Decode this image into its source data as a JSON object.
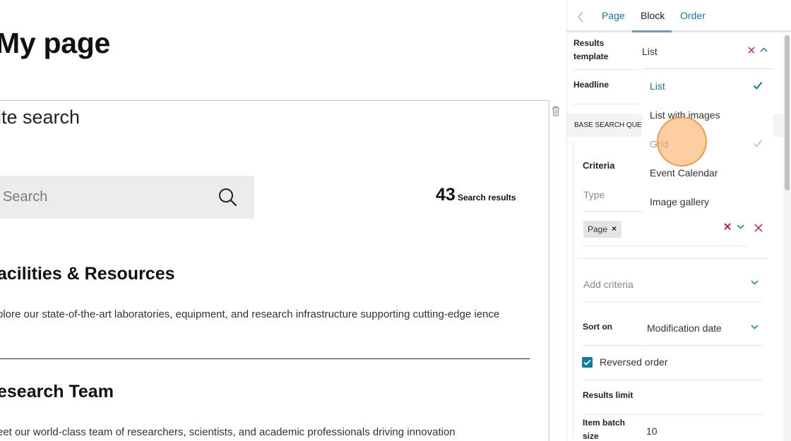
{
  "page": {
    "title": "My page"
  },
  "block": {
    "title": "ite search",
    "search": {
      "placeholder": "Search"
    },
    "results": {
      "count": "43",
      "count_label": "Search results"
    },
    "items": [
      {
        "title": "acilities & Resources",
        "description": "plore our state-of-the-art laboratories, equipment, and research infrastructure supporting cutting-edge ience"
      },
      {
        "title": "esearch Team",
        "description": "eet our world-class team of researchers, scientists, and academic professionals driving innovation"
      }
    ]
  },
  "sidebar": {
    "tabs": [
      {
        "label": "Page",
        "active": false
      },
      {
        "label": "Block",
        "active": true
      },
      {
        "label": "Order",
        "active": false
      }
    ],
    "fields": {
      "results_template_label": "Results template",
      "results_template_value": "List",
      "headline_label": "Headline",
      "section_title": "BASE SEARCH QUER",
      "criteria_label": "Criteria",
      "type_label": "Type",
      "type_chip": "Page",
      "add_criteria_placeholder": "Add criteria",
      "sort_on_label": "Sort on",
      "sort_on_value": "Modification date",
      "reversed_order_label": "Reversed order",
      "reversed_order_checked": true,
      "results_limit_label": "Results limit",
      "item_batch_size_label": "Item batch size",
      "item_batch_size_value": "10"
    },
    "template_options": [
      {
        "label": "List",
        "state": "selected"
      },
      {
        "label": "List with images",
        "state": "normal"
      },
      {
        "label": "Grid",
        "state": "disabled"
      },
      {
        "label": "Event Calendar",
        "state": "normal"
      },
      {
        "label": "Image gallery",
        "state": "normal"
      }
    ]
  },
  "colors": {
    "accent": "#137aa3",
    "danger": "#c2185b",
    "frame": "#a9d4e6"
  }
}
